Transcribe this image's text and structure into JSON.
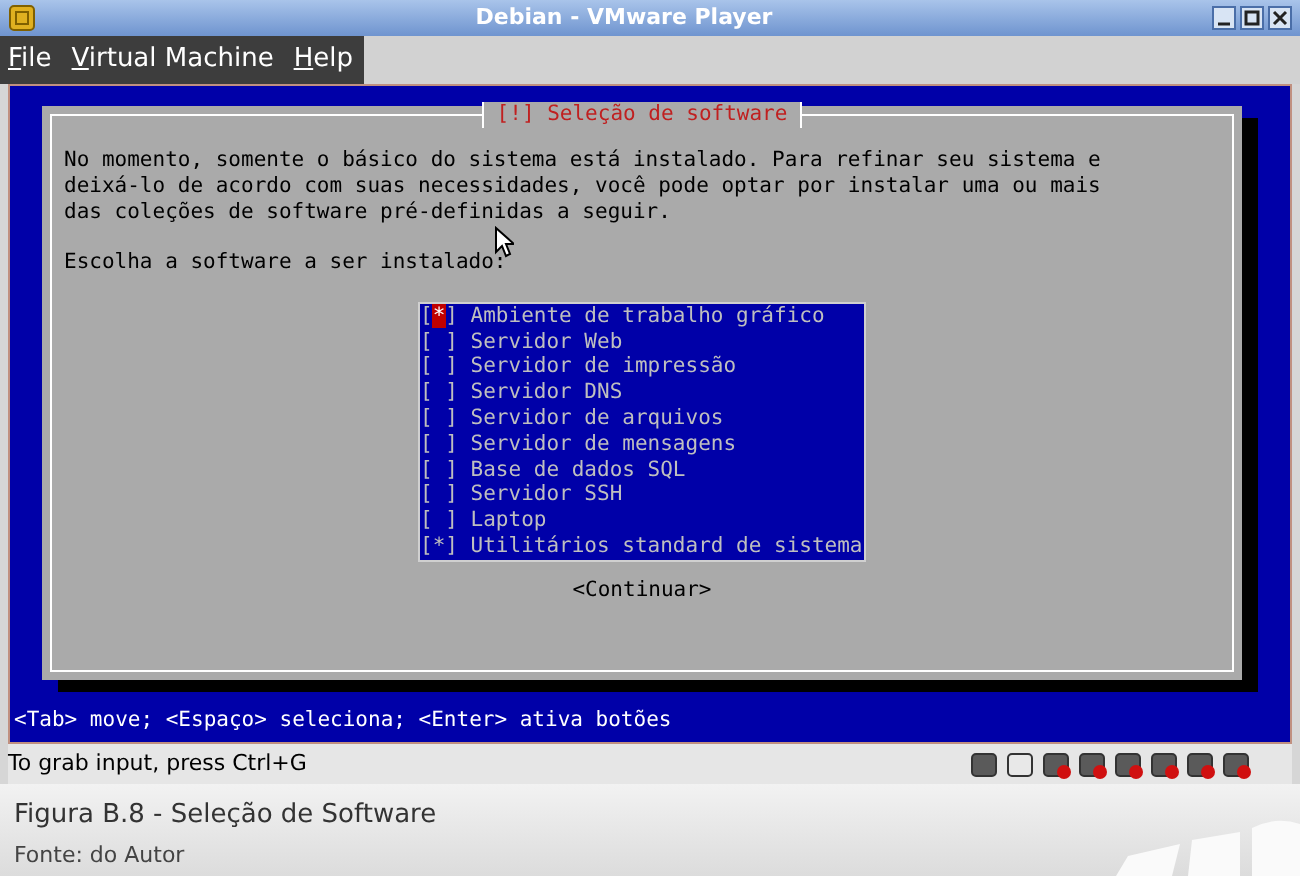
{
  "window": {
    "title": "Debian - VMware Player"
  },
  "menu": [
    {
      "label": "File"
    },
    {
      "label": "Virtual Machine"
    },
    {
      "label": "Help"
    }
  ],
  "dialog": {
    "title": "[!] Seleção de software",
    "intro": "No momento, somente o básico do sistema está instalado. Para refinar seu sistema e deixá-lo de acordo com suas necessidades, você pode optar por instalar uma ou mais das coleções de software pré-definidas a seguir.",
    "prompt": "Escolha a software a ser instalado:",
    "bracket_open": "[",
    "bracket_close": "]",
    "check_mark": "*",
    "options": [
      {
        "label": "Ambiente de trabalho gráfico",
        "checked": true,
        "focused": true
      },
      {
        "label": "Servidor Web",
        "checked": false,
        "focused": false
      },
      {
        "label": "Servidor de impressão",
        "checked": false,
        "focused": false
      },
      {
        "label": "Servidor DNS",
        "checked": false,
        "focused": false
      },
      {
        "label": "Servidor de arquivos",
        "checked": false,
        "focused": false
      },
      {
        "label": "Servidor de mensagens",
        "checked": false,
        "focused": false
      },
      {
        "label": "Base de dados SQL",
        "checked": false,
        "focused": false
      },
      {
        "label": "Servidor SSH",
        "checked": false,
        "focused": false
      },
      {
        "label": "Laptop",
        "checked": false,
        "focused": false
      },
      {
        "label": "Utilitários standard de sistema",
        "checked": true,
        "focused": false
      }
    ],
    "button": "<Continuar>"
  },
  "help_line": "<Tab> move; <Espaço> seleciona; <Enter> ativa botões",
  "status_bar": {
    "text": "To grab input, press Ctrl+G"
  },
  "caption": {
    "title": "Figura B.8 - Seleção de Software",
    "source": "Fonte: do Autor"
  }
}
